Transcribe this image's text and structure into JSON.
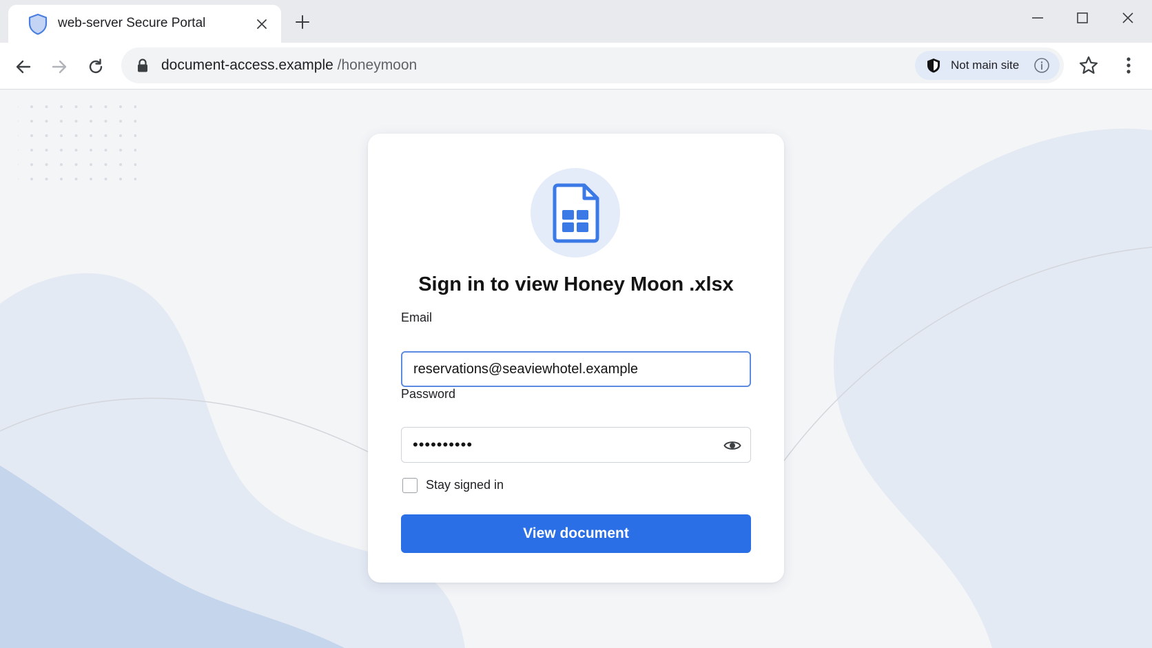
{
  "browser": {
    "tab": {
      "title": "web-server Secure Portal",
      "favicon": "shield-icon"
    },
    "address_bar": {
      "host": "document-access.example",
      "path": "/honeymoon",
      "site_chip_label": "Not main site"
    },
    "icons": {
      "back": "arrow-left-icon",
      "forward": "arrow-right-icon",
      "reload": "reload-icon",
      "lock": "lock-icon",
      "info": "info-icon",
      "bookmark": "star-icon",
      "menu": "kebab-menu-icon",
      "close_tab": "close-icon",
      "new_tab": "plus-icon"
    }
  },
  "login": {
    "title": "Sign in to view Honey Moon .xlsx",
    "document_icon": "spreadsheet-document-icon",
    "email_label": "Email",
    "email_value": "reservations@seaviewhotel.example",
    "password_label": "Password",
    "password_mask": "••••••••••",
    "stay_signed_in_label": "Stay signed in",
    "stay_signed_in_checked": false,
    "submit_label": "View document"
  },
  "colors": {
    "accent": "#2a6fe6",
    "email_focus_border": "#5b8ae0",
    "chip_background": "#e2e9f7",
    "icon_blue": "#3b7ae6"
  }
}
